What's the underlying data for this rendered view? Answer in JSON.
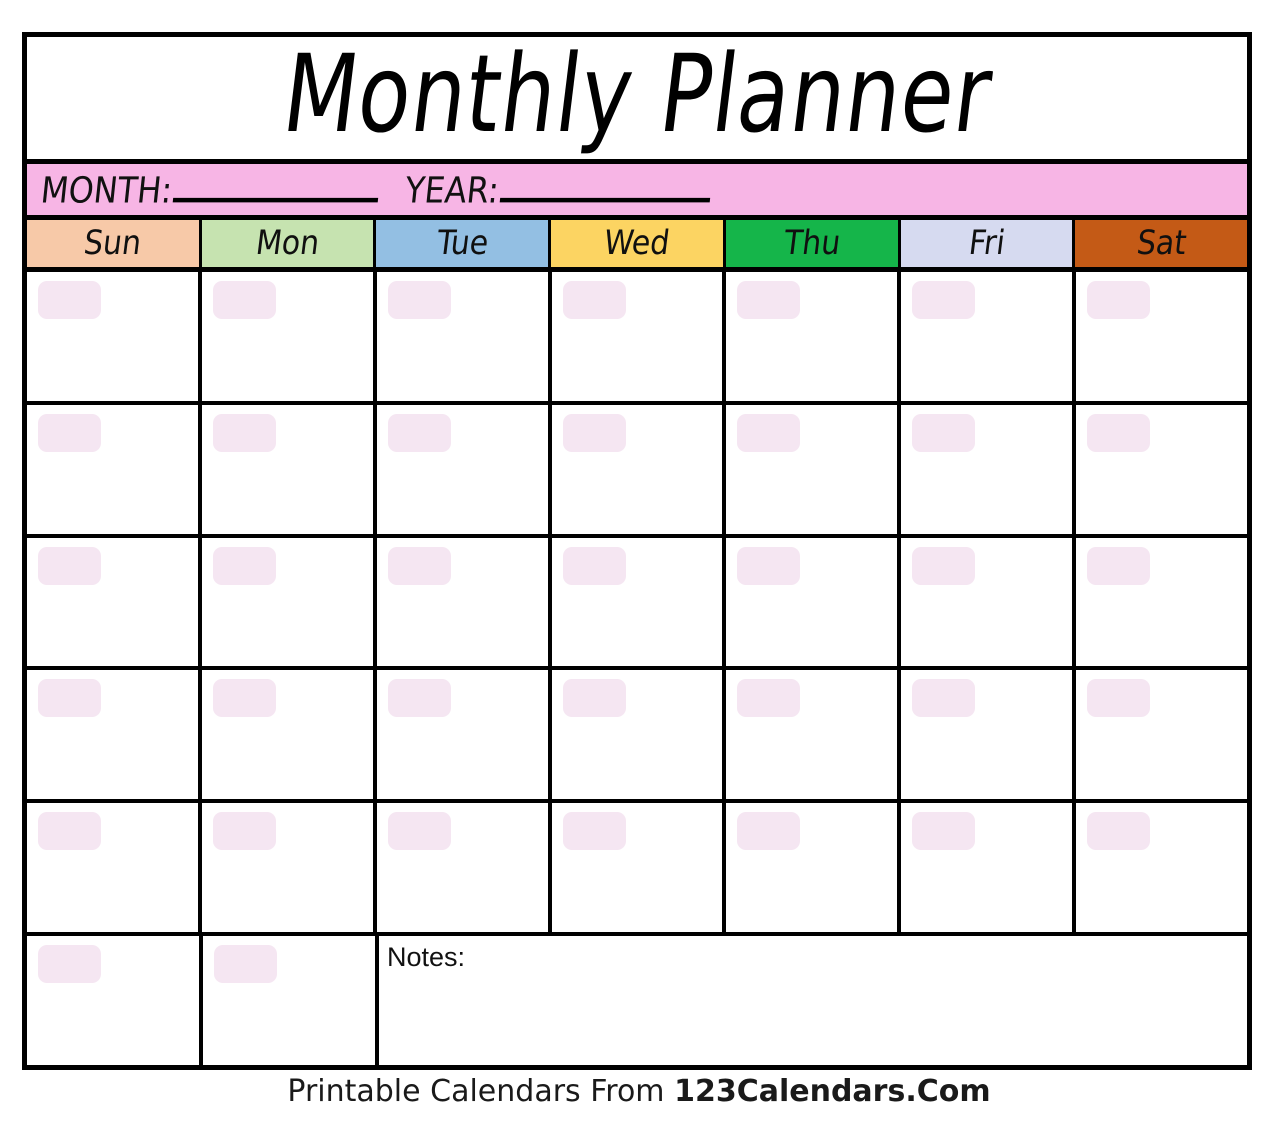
{
  "title": "Monthly Planner",
  "month_year_bar": {
    "month_label": "MONTH:",
    "month_blank": "___________",
    "year_label": "YEAR:",
    "year_blank": "___________"
  },
  "weekdays": [
    {
      "label": "Sun",
      "color": "#F7C9A8"
    },
    {
      "label": "Mon",
      "color": "#C6E3B0"
    },
    {
      "label": "Tue",
      "color": "#93BFE3"
    },
    {
      "label": "Wed",
      "color": "#FCD462"
    },
    {
      "label": "Thu",
      "color": "#15B54A"
    },
    {
      "label": "Fri",
      "color": "#D6DAF0"
    },
    {
      "label": "Sat",
      "color": "#C45A16"
    }
  ],
  "grid": {
    "rows": 6,
    "columns": 7,
    "date_boxes_per_full_row": 7,
    "last_row_day_cells": 2,
    "date_box_color": "#F5E6F2",
    "cell_background": "#FFFFFF",
    "all_dates_blank": true
  },
  "notes": {
    "label": "Notes:",
    "value": ""
  },
  "footer": {
    "prefix": "Printable Calendars From ",
    "brand": "123Calendars.Com"
  },
  "colors": {
    "border": "#000000",
    "month_band": "#F7B5E5",
    "page_background": "#FFFFFF",
    "text": "#000000"
  }
}
